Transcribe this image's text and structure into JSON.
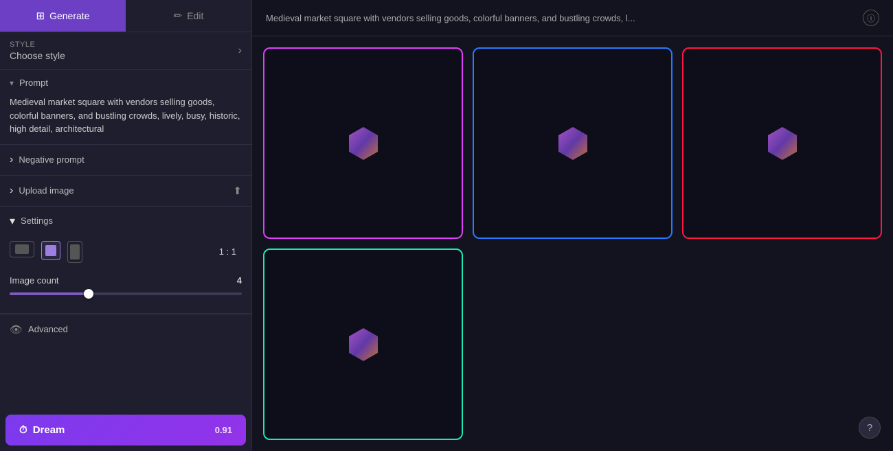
{
  "tabs": [
    {
      "id": "generate",
      "label": "Generate",
      "icon": "⊞",
      "active": true
    },
    {
      "id": "edit",
      "label": "Edit",
      "icon": "✏",
      "active": false
    }
  ],
  "style": {
    "label": "Style",
    "value": "Choose style"
  },
  "prompt": {
    "section_label": "Prompt",
    "text": "Medieval market square with vendors selling goods, colorful banners, and bustling crowds, lively, busy, historic, high detail, architectural"
  },
  "negative_prompt": {
    "label": "Negative prompt"
  },
  "upload_image": {
    "label": "Upload image"
  },
  "settings": {
    "label": "Settings",
    "aspect_ratio": "1 : 1",
    "image_count_label": "Image count",
    "image_count_value": "4",
    "slider_percent": 35
  },
  "advanced": {
    "label": "Advanced"
  },
  "dream_button": {
    "label": "Dream",
    "cost": "0.91"
  },
  "header": {
    "prompt_preview": "Medieval market square with vendors selling goods, colorful banners, and bustling crowds, l..."
  },
  "images": [
    {
      "id": 1,
      "border": "pink"
    },
    {
      "id": 2,
      "border": "blue"
    },
    {
      "id": 3,
      "border": "red"
    },
    {
      "id": 4,
      "border": "teal"
    }
  ],
  "help_label": "?"
}
